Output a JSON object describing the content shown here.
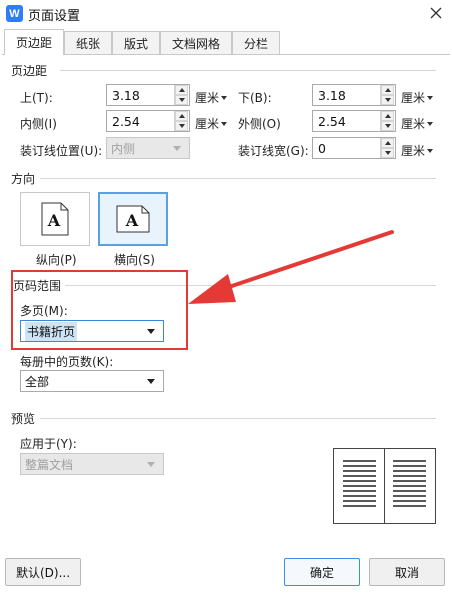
{
  "window": {
    "title": "页面设置",
    "app_icon_letter": "W",
    "brand_color": "#2f7df6"
  },
  "tabs": [
    {
      "label": "页边距",
      "active": true
    },
    {
      "label": "纸张"
    },
    {
      "label": "版式"
    },
    {
      "label": "文档网格"
    },
    {
      "label": "分栏"
    }
  ],
  "margins": {
    "section_title": "页边距",
    "top": {
      "label": "上(T):",
      "value": "3.18",
      "unit": "厘米"
    },
    "bottom": {
      "label": "下(B):",
      "value": "3.18",
      "unit": "厘米"
    },
    "inner": {
      "label": "内侧(I)",
      "value": "2.54",
      "unit": "厘米"
    },
    "outer": {
      "label": "外侧(O)",
      "value": "2.54",
      "unit": "厘米"
    },
    "gutter_position": {
      "label": "装订线位置(U):",
      "value": "内侧",
      "disabled": true
    },
    "gutter_width": {
      "label": "装订线宽(G):",
      "value": "0",
      "unit": "厘米"
    }
  },
  "orientation": {
    "section_title": "方向",
    "portrait": {
      "label": "纵向(P)",
      "glyph": "A"
    },
    "landscape": {
      "label": "横向(S)",
      "glyph": "A",
      "selected": true
    }
  },
  "page_range": {
    "section_title": "页码范围",
    "multiple_pages": {
      "label": "多页(M):",
      "value": "书籍折页"
    },
    "sheets_per_booklet": {
      "label": "每册中的页数(K):",
      "value": "全部"
    },
    "highlight_color": "#e53935"
  },
  "preview": {
    "section_title": "预览",
    "apply_to": {
      "label": "应用于(Y):",
      "value": "整篇文档",
      "disabled": true
    }
  },
  "buttons": {
    "default": "默认(D)...",
    "ok": "确定",
    "cancel": "取消"
  }
}
